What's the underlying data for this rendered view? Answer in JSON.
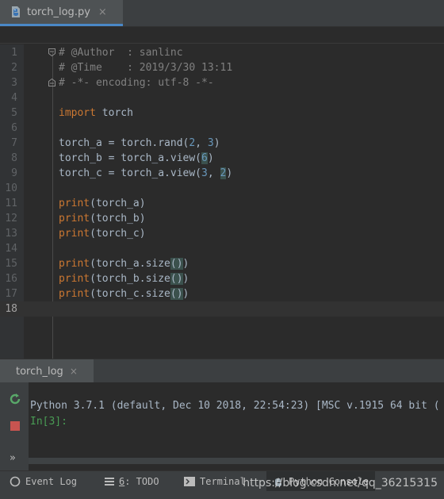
{
  "tab": {
    "filename": "torch_log.py",
    "close": "×"
  },
  "editor": {
    "lines": [
      {
        "n": "1",
        "tokens": [
          [
            "cmt",
            "# @Author  : sanlinc"
          ]
        ],
        "fold": "top"
      },
      {
        "n": "2",
        "tokens": [
          [
            "cmt",
            "# @Time    : 2019/3/30 13:11"
          ]
        ]
      },
      {
        "n": "3",
        "tokens": [
          [
            "cmt",
            "# -*- encoding: utf-8 -*-"
          ]
        ],
        "fold": "bottom"
      },
      {
        "n": "4",
        "tokens": []
      },
      {
        "n": "5",
        "tokens": [
          [
            "kw",
            "import"
          ],
          [
            "plain",
            " torch"
          ]
        ]
      },
      {
        "n": "6",
        "tokens": []
      },
      {
        "n": "7",
        "tokens": [
          [
            "plain",
            "torch_a = torch.rand("
          ],
          [
            "num",
            "2"
          ],
          [
            "plain",
            ", "
          ],
          [
            "num",
            "3"
          ],
          [
            "plain",
            ")"
          ]
        ]
      },
      {
        "n": "8",
        "tokens": [
          [
            "plain",
            "torch_b = torch_a.view("
          ],
          [
            "numhl",
            "6"
          ],
          [
            "plain",
            ")"
          ]
        ]
      },
      {
        "n": "9",
        "tokens": [
          [
            "plain",
            "torch_c = torch_a.view("
          ],
          [
            "num",
            "3"
          ],
          [
            "plain",
            ", "
          ],
          [
            "numhl",
            "2"
          ],
          [
            "plain",
            ")"
          ]
        ]
      },
      {
        "n": "10",
        "tokens": []
      },
      {
        "n": "11",
        "tokens": [
          [
            "kw",
            "print"
          ],
          [
            "plain",
            "(torch_a)"
          ]
        ]
      },
      {
        "n": "12",
        "tokens": [
          [
            "kw",
            "print"
          ],
          [
            "plain",
            "(torch_b)"
          ]
        ]
      },
      {
        "n": "13",
        "tokens": [
          [
            "kw",
            "print"
          ],
          [
            "plain",
            "(torch_c)"
          ]
        ]
      },
      {
        "n": "14",
        "tokens": []
      },
      {
        "n": "15",
        "tokens": [
          [
            "kw",
            "print"
          ],
          [
            "plain",
            "(torch_a.size"
          ],
          [
            "hl",
            "()"
          ],
          [
            "plain",
            ")"
          ]
        ]
      },
      {
        "n": "16",
        "tokens": [
          [
            "kw",
            "print"
          ],
          [
            "plain",
            "(torch_b.size"
          ],
          [
            "hl",
            "()"
          ],
          [
            "plain",
            ")"
          ]
        ]
      },
      {
        "n": "17",
        "tokens": [
          [
            "kw",
            "print"
          ],
          [
            "plain",
            "(torch_c.size"
          ],
          [
            "hl",
            "()"
          ],
          [
            "plain",
            ")"
          ]
        ]
      },
      {
        "n": "18",
        "tokens": [],
        "current": true
      }
    ]
  },
  "run": {
    "tab_label": "torch_log",
    "tab_close": "×",
    "more": "»",
    "console_line": "Python 3.7.1 (default, Dec 10 2018, 22:54:23) [MSC v.1915 64 bit (",
    "prompt": "In[3]:"
  },
  "statusbar": {
    "event_log": "Event Log",
    "todo_num": "6",
    "todo_rest": ": TODO",
    "terminal": "Terminal",
    "python_console": "Python Console"
  },
  "watermark": "https://blog.csdn.net/qq_36215315",
  "colors": {
    "editor_bg": "#2b2b2b",
    "comment": "#808080",
    "keyword": "#cc7832",
    "number": "#6897bb",
    "prompt": "#499c54",
    "tab_underline": "#4a88c7"
  }
}
